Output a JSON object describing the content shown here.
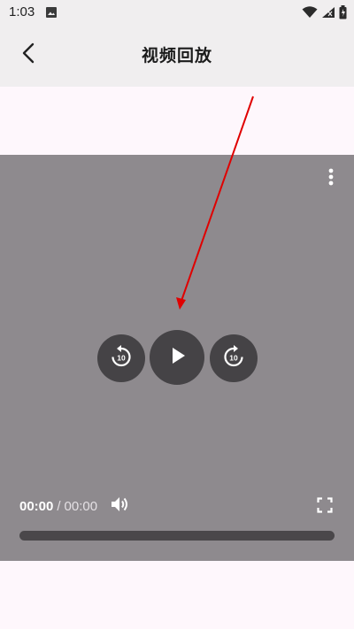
{
  "status_bar": {
    "time": "1:03",
    "icons": [
      "gallery-icon",
      "wifi-icon",
      "signal-icon",
      "battery-icon"
    ]
  },
  "header": {
    "title": "视频回放",
    "back_icon": "chevron-left-icon"
  },
  "player": {
    "current_time": "00:00",
    "separator": "/",
    "total_time": "00:00",
    "progress": 0,
    "rewind_seconds": "10",
    "forward_seconds": "10",
    "icons": [
      "more-vert-icon",
      "replay-10-icon",
      "play-icon",
      "forward-10-icon",
      "volume-icon",
      "fullscreen-icon"
    ]
  },
  "annotation": {
    "type": "arrow",
    "color": "#E00000"
  },
  "colors": {
    "player_bg": "#8E8A8E",
    "control_bg": "#454346",
    "app_bar": "#F0EEEF",
    "page_bg": "#FEF7FC"
  }
}
